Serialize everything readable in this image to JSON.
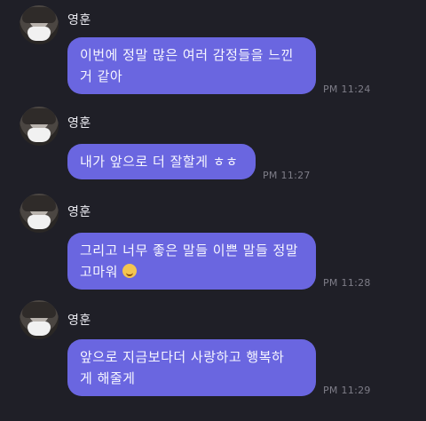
{
  "sender_name": "영훈",
  "messages": [
    {
      "name": "영훈",
      "text": "이번에 정말 많은 여러 감정들을 느낀\n거 같아",
      "time": "PM 11:24"
    },
    {
      "name": "영훈",
      "text": "내가 앞으로 더 잘할게 ㅎㅎ",
      "time": "PM 11:27"
    },
    {
      "name": "영훈",
      "text": "그리고 너무 좋은 말들 이쁜 말들 정말\n고마워",
      "emoji": "smiling-face-emoji",
      "time": "PM 11:28"
    },
    {
      "name": "영훈",
      "text": "앞으로 지금보다더 사랑하고 행복하\n게 해줄게",
      "time": "PM 11:29"
    }
  ],
  "colors": {
    "background": "#1f1f27",
    "bubble": "#6a66e0",
    "time": "#7e7d88",
    "name": "#eaeaf0"
  }
}
